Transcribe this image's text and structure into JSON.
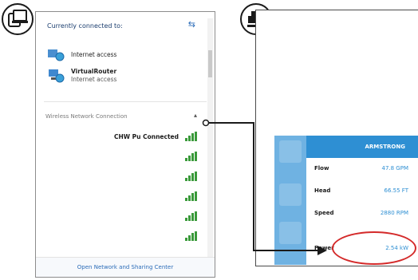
{
  "network_flyout": {
    "header": "Currently connected to:",
    "connections": [
      {
        "name": "Internet access",
        "status": ""
      },
      {
        "name": "VirtualRouter",
        "status": "Internet access"
      }
    ],
    "section_title": "Wireless Network Connection",
    "networks": [
      {
        "name": "CHW Pu Connected"
      },
      {
        "name": ""
      },
      {
        "name": ""
      },
      {
        "name": ""
      },
      {
        "name": ""
      },
      {
        "name": ""
      }
    ],
    "footer_link": "Open Network and Sharing Center"
  },
  "pump_screen": {
    "brand": "ARMSTRONG",
    "rows": [
      {
        "label": "Flow",
        "value": "47.8 GPM"
      },
      {
        "label": "Head",
        "value": "66.55 FT"
      },
      {
        "label": "Speed",
        "value": "2880 RPM"
      },
      {
        "label": "Power",
        "value": "2.54 kW"
      }
    ]
  },
  "icons": {
    "left_badge": "devices-icon",
    "right_badge": "pump-icon"
  },
  "colors": {
    "accent_blue": "#2e8fd3",
    "highlight_red": "#d42a2a",
    "signal_green": "#3a9a3a"
  }
}
